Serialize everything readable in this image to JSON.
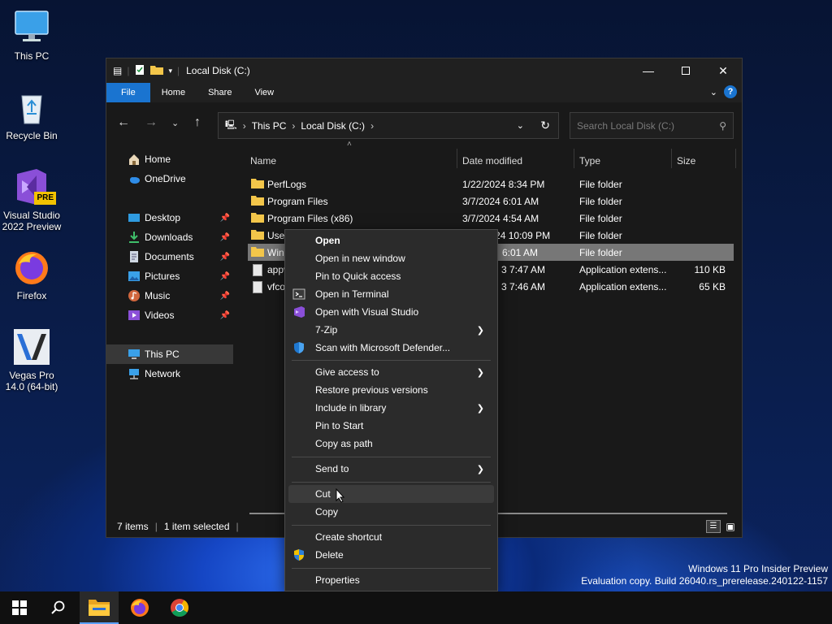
{
  "desktop": {
    "icons": [
      {
        "label": "This PC"
      },
      {
        "label": "Recycle Bin"
      },
      {
        "label": "Visual Studio 2022 Preview",
        "badge": "PRE"
      },
      {
        "label": "Firefox"
      },
      {
        "label": "Vegas Pro 14.0 (64-bit)"
      }
    ]
  },
  "window": {
    "title": "Local Disk (C:)",
    "ribbon_tabs": [
      "File",
      "Home",
      "Share",
      "View"
    ],
    "help_label": "?",
    "breadcrumb": [
      "This PC",
      "Local Disk (C:)"
    ],
    "search_placeholder": "Search Local Disk (C:)",
    "sidebar": [
      {
        "label": "Home",
        "icon": "home-icon"
      },
      {
        "label": "OneDrive",
        "icon": "cloud-icon"
      },
      {
        "label": "Desktop",
        "icon": "desktop-icon",
        "pinned": true
      },
      {
        "label": "Downloads",
        "icon": "download-icon",
        "pinned": true
      },
      {
        "label": "Documents",
        "icon": "documents-icon",
        "pinned": true
      },
      {
        "label": "Pictures",
        "icon": "pictures-icon",
        "pinned": true
      },
      {
        "label": "Music",
        "icon": "music-icon",
        "pinned": true
      },
      {
        "label": "Videos",
        "icon": "videos-icon",
        "pinned": true
      },
      {
        "label": "This PC",
        "icon": "computer-icon",
        "selected": true
      },
      {
        "label": "Network",
        "icon": "network-icon"
      }
    ],
    "columns": [
      "Name",
      "Date modified",
      "Type",
      "Size"
    ],
    "rows": [
      {
        "name": "PerfLogs",
        "date": "1/22/2024 8:34 PM",
        "type": "File folder",
        "size": "",
        "kind": "folder"
      },
      {
        "name": "Program Files",
        "date": "3/7/2024 6:01 AM",
        "type": "File folder",
        "size": "",
        "kind": "folder"
      },
      {
        "name": "Program Files (x86)",
        "date": "3/7/2024 4:54 AM",
        "type": "File folder",
        "size": "",
        "kind": "folder"
      },
      {
        "name": "User",
        "date": "1/22/2024 10:09 PM",
        "type": "File folder",
        "size": "",
        "kind": "folder"
      },
      {
        "name": "Win",
        "date": "6:01 AM",
        "type": "File folder",
        "size": "",
        "kind": "folder",
        "selected": true
      },
      {
        "name": "appv",
        "date": "3 7:47 AM",
        "type": "Application extens...",
        "size": "110 KB",
        "kind": "file"
      },
      {
        "name": "vfco",
        "date": "3 7:46 AM",
        "type": "Application extens...",
        "size": "65 KB",
        "kind": "file"
      }
    ],
    "status": {
      "items": "7 items",
      "selected": "1 item selected"
    }
  },
  "context_menu": {
    "items": [
      {
        "label": "Open",
        "bold": true
      },
      {
        "label": "Open in new window"
      },
      {
        "label": "Pin to Quick access"
      },
      {
        "label": "Open in Terminal",
        "icon": "terminal-icon"
      },
      {
        "label": "Open with Visual Studio",
        "icon": "visual-studio-icon"
      },
      {
        "label": "7-Zip",
        "submenu": true
      },
      {
        "label": "Scan with Microsoft Defender...",
        "icon": "defender-shield-icon"
      },
      {
        "label": "Give access to",
        "submenu": true
      },
      {
        "label": "Restore previous versions"
      },
      {
        "label": "Include in library",
        "submenu": true
      },
      {
        "label": "Pin to Start"
      },
      {
        "label": "Copy as path"
      },
      {
        "label": "Send to",
        "submenu": true
      },
      {
        "label": "Cut",
        "hover": true
      },
      {
        "label": "Copy"
      },
      {
        "label": "Create shortcut"
      },
      {
        "label": "Delete",
        "icon": "uac-shield-icon"
      },
      {
        "label": "Properties"
      }
    ]
  },
  "watermark": {
    "line1": "Windows 11 Pro Insider Preview",
    "line2": "Evaluation copy. Build 26040.rs_prerelease.240122-1157"
  },
  "taskbar": {
    "items": [
      "start-button",
      "search-button",
      "file-explorer-button",
      "firefox-button",
      "chrome-button"
    ]
  }
}
